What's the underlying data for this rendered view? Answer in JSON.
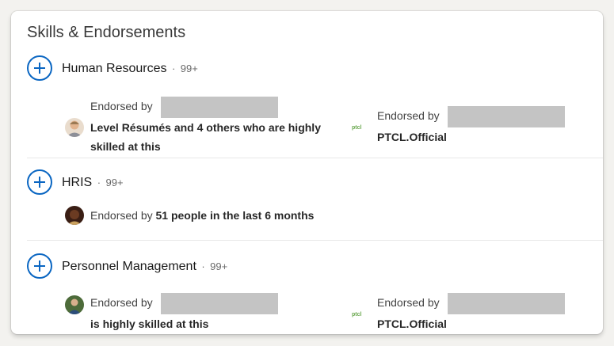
{
  "card": {
    "title": "Skills & Endorsements"
  },
  "skills": [
    {
      "name": "Human Resources",
      "separator": "·",
      "count": "99+",
      "left": {
        "prefix": "Endorsed by",
        "text": "Level Résumés and 4 others who are highly skilled at this",
        "avatar_icon": "person-avatar-icon"
      },
      "right": {
        "prefix": "Endorsed by",
        "text": "PTCL.Official",
        "logo_text": "ptcl"
      }
    },
    {
      "name": "HRIS",
      "separator": "·",
      "count": "99+",
      "left": {
        "prefix": "Endorsed by",
        "text": "51 people in the last 6 months",
        "avatar_icon": "person-avatar-icon"
      }
    },
    {
      "name": "Personnel Management",
      "separator": "·",
      "count": "99+",
      "left": {
        "prefix": "Endorsed by",
        "text": "is highly skilled at this",
        "avatar_icon": "person-avatar-icon"
      },
      "right": {
        "prefix": "Endorsed by",
        "text": "PTCL.Official",
        "logo_text": "ptcl"
      }
    }
  ],
  "colors": {
    "accent": "#0a66c2",
    "redaction": "#c4c4c4",
    "divider": "#e8e8e8"
  }
}
